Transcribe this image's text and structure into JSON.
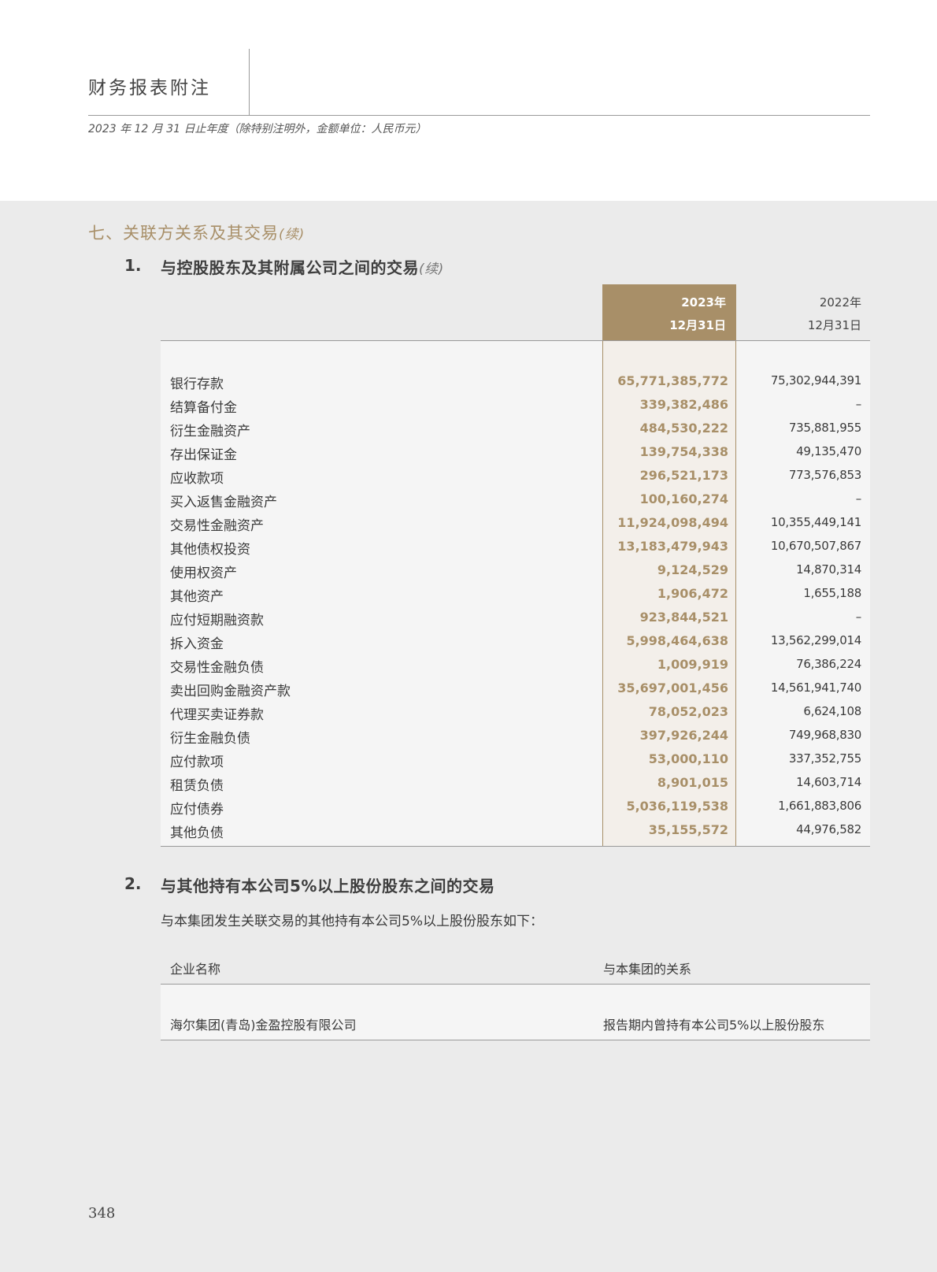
{
  "header": {
    "title": "财务报表附注",
    "subtitle": "2023 年 12 月 31 日止年度（除特别注明外，金额单位：人民币元）"
  },
  "section": {
    "title": "七、关联方关系及其交易",
    "cont": "(续)"
  },
  "sub1": {
    "number": "1.",
    "title": "与控股股东及其附属公司之间的交易",
    "cont": "(续)"
  },
  "table1": {
    "col_current": {
      "year": "2023年",
      "date": "12月31日"
    },
    "col_prior": {
      "year": "2022年",
      "date": "12月31日"
    },
    "rows": [
      {
        "label": "银行存款",
        "current": "65,771,385,772",
        "prior": "75,302,944,391"
      },
      {
        "label": "结算备付金",
        "current": "339,382,486",
        "prior": "–"
      },
      {
        "label": "衍生金融资产",
        "current": "484,530,222",
        "prior": "735,881,955"
      },
      {
        "label": "存出保证金",
        "current": "139,754,338",
        "prior": "49,135,470"
      },
      {
        "label": "应收款项",
        "current": "296,521,173",
        "prior": "773,576,853"
      },
      {
        "label": "买入返售金融资产",
        "current": "100,160,274",
        "prior": "–"
      },
      {
        "label": "交易性金融资产",
        "current": "11,924,098,494",
        "prior": "10,355,449,141"
      },
      {
        "label": "其他债权投资",
        "current": "13,183,479,943",
        "prior": "10,670,507,867"
      },
      {
        "label": "使用权资产",
        "current": "9,124,529",
        "prior": "14,870,314"
      },
      {
        "label": "其他资产",
        "current": "1,906,472",
        "prior": "1,655,188"
      },
      {
        "label": "应付短期融资款",
        "current": "923,844,521",
        "prior": "–"
      },
      {
        "label": "拆入资金",
        "current": "5,998,464,638",
        "prior": "13,562,299,014"
      },
      {
        "label": "交易性金融负债",
        "current": "1,009,919",
        "prior": "76,386,224"
      },
      {
        "label": "卖出回购金融资产款",
        "current": "35,697,001,456",
        "prior": "14,561,941,740"
      },
      {
        "label": "代理买卖证券款",
        "current": "78,052,023",
        "prior": "6,624,108"
      },
      {
        "label": "衍生金融负债",
        "current": "397,926,244",
        "prior": "749,968,830"
      },
      {
        "label": "应付款项",
        "current": "53,000,110",
        "prior": "337,352,755"
      },
      {
        "label": "租赁负债",
        "current": "8,901,015",
        "prior": "14,603,714"
      },
      {
        "label": "应付债券",
        "current": "5,036,119,538",
        "prior": "1,661,883,806"
      },
      {
        "label": "其他负债",
        "current": "35,155,572",
        "prior": "44,976,582"
      }
    ]
  },
  "sub2": {
    "number": "2.",
    "title": "与其他持有本公司5%以上股份股东之间的交易",
    "intro": "与本集团发生关联交易的其他持有本公司5%以上股份股东如下：",
    "col_name": "企业名称",
    "col_relation": "与本集团的关系",
    "rows": [
      {
        "name": "海尔集团(青岛)金盈控股有限公司",
        "relation": "报告期内曾持有本公司5%以上股份股东"
      }
    ]
  },
  "footer": {
    "page": "348"
  }
}
